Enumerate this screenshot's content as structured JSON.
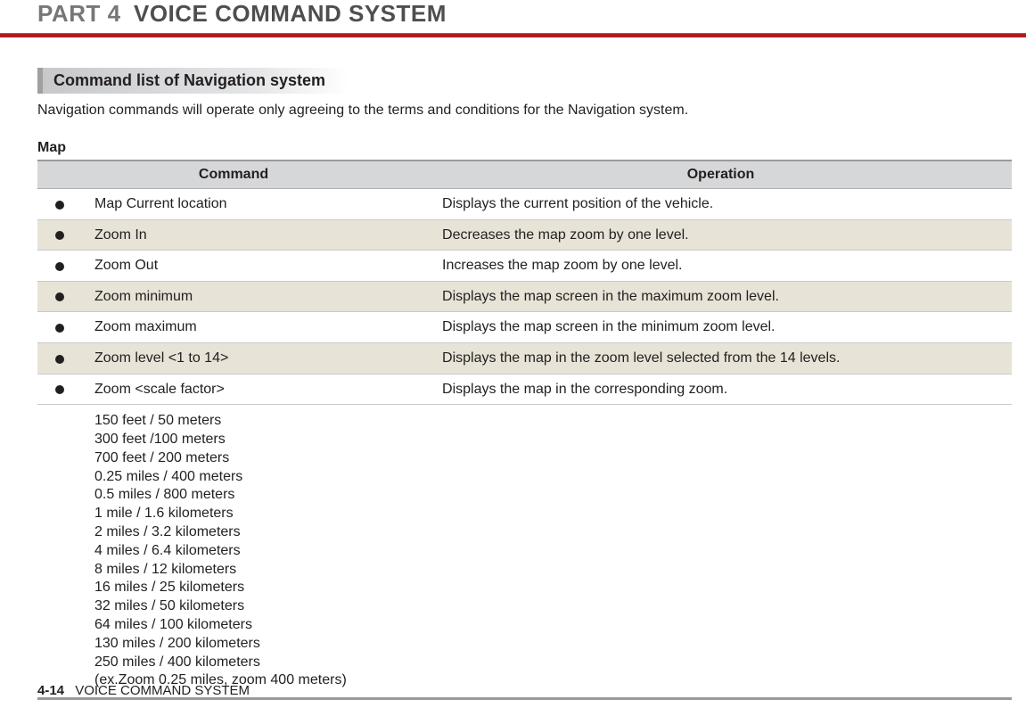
{
  "header": {
    "part": "PART 4",
    "chapter": "VOICE COMMAND SYSTEM"
  },
  "section_heading": "Command list of Navigation system",
  "intro": "Navigation commands will operate only agreeing to the terms and  conditions for the Navigation system.",
  "sub_heading": "Map",
  "table": {
    "headers": {
      "command": "Command",
      "operation": "Operation"
    },
    "rows": [
      {
        "bullet": true,
        "command": "Map Current location",
        "operation": "Displays the current position of the vehicle."
      },
      {
        "bullet": true,
        "command": "Zoom In",
        "operation": "Decreases the map zoom by one level."
      },
      {
        "bullet": true,
        "command": "Zoom Out",
        "operation": "Increases the map zoom by one level."
      },
      {
        "bullet": true,
        "command": "Zoom minimum",
        "operation": "Displays the map screen in the maximum zoom level."
      },
      {
        "bullet": true,
        "command": "Zoom maximum",
        "operation": "Displays the map screen in the minimum zoom level."
      },
      {
        "bullet": true,
        "command": "Zoom level <1 to 14>",
        "operation": "Displays the map in the zoom level selected from the 14 levels."
      },
      {
        "bullet": true,
        "command": "Zoom <scale factor>",
        "operation": "Displays the map in the corresponding zoom."
      },
      {
        "bullet": false,
        "command": "150 feet / 50 meters\n300 feet /100 meters\n700 feet / 200 meters\n0.25 miles / 400 meters\n0.5 miles / 800 meters\n1 mile / 1.6 kilometers\n2 miles / 3.2 kilometers\n4 miles / 6.4 kilometers\n8 miles / 12 kilometers\n16 miles / 25 kilometers\n32 miles / 50 kilometers\n64 miles / 100 kilometers\n130 miles / 200 kilometers\n250 miles / 400 kilometers\n(ex.Zoom 0.25 miles, zoom 400 meters)",
        "operation": ""
      }
    ]
  },
  "footer": {
    "page_number": "4-14",
    "running_title": "VOICE COMMAND SYSTEM"
  }
}
